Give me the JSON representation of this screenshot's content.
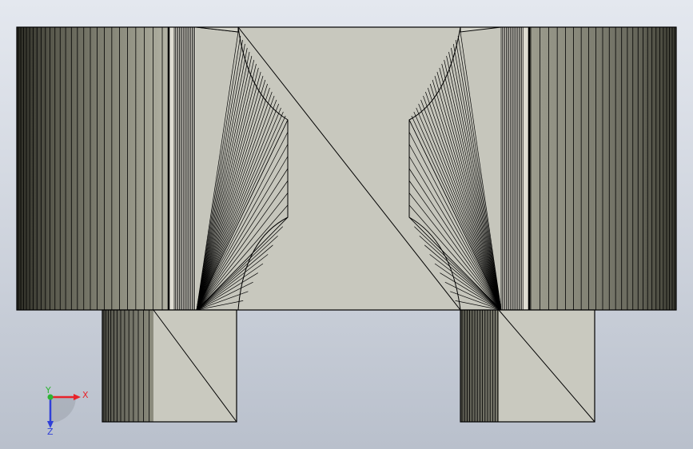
{
  "triad": {
    "x_label": "X",
    "y_label": "Y",
    "z_label": "Z",
    "x_color": "#e8232a",
    "y_color": "#2cb432",
    "z_color": "#2f3fd8"
  },
  "colors": {
    "face": "#c6c6bc",
    "edge": "#000000",
    "shade_dark": "#4e4e44",
    "shade_light": "#bcbcae"
  }
}
